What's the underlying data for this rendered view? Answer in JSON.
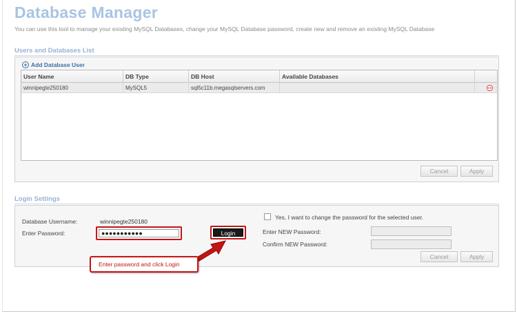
{
  "header": {
    "title": "Database Manager",
    "subtitle": "You can use this tool to manage your existing MySQL Databases, change your MySQL Database password, create new and remove an existing MySQL Database"
  },
  "users_section": {
    "title": "Users and Databases List",
    "add_user_label": "Add Database User",
    "columns": [
      "User Name",
      "DB Type",
      "DB Host",
      "Available Databases",
      ""
    ],
    "rows": [
      {
        "user_name": "winnipegte250180",
        "db_type": "MySQL5",
        "db_host": "sql5c11b.megasqlservers.com",
        "available_databases": ""
      }
    ],
    "cancel_label": "Cancel",
    "apply_label": "Apply"
  },
  "login_section": {
    "title": "Login Settings",
    "username_label": "Database Username:",
    "username_value": "winnipegte250180",
    "password_label": "Enter Password:",
    "password_value": "●●●●●●●●●●●",
    "login_label": "Login",
    "change_pw_checkbox_label": "Yes, I want to change the password for the selected user.",
    "new_password_label": "Enter NEW Password:",
    "confirm_password_label": "Confirm NEW Password:",
    "cancel_label": "Cancel",
    "apply_label": "Apply"
  },
  "annotation": {
    "callout_text": "Enter password and click Login"
  },
  "colors": {
    "title": "#a8c4e3",
    "section_title": "#98b3d3",
    "link": "#3a6ea5",
    "highlight_red": "#c41414"
  }
}
